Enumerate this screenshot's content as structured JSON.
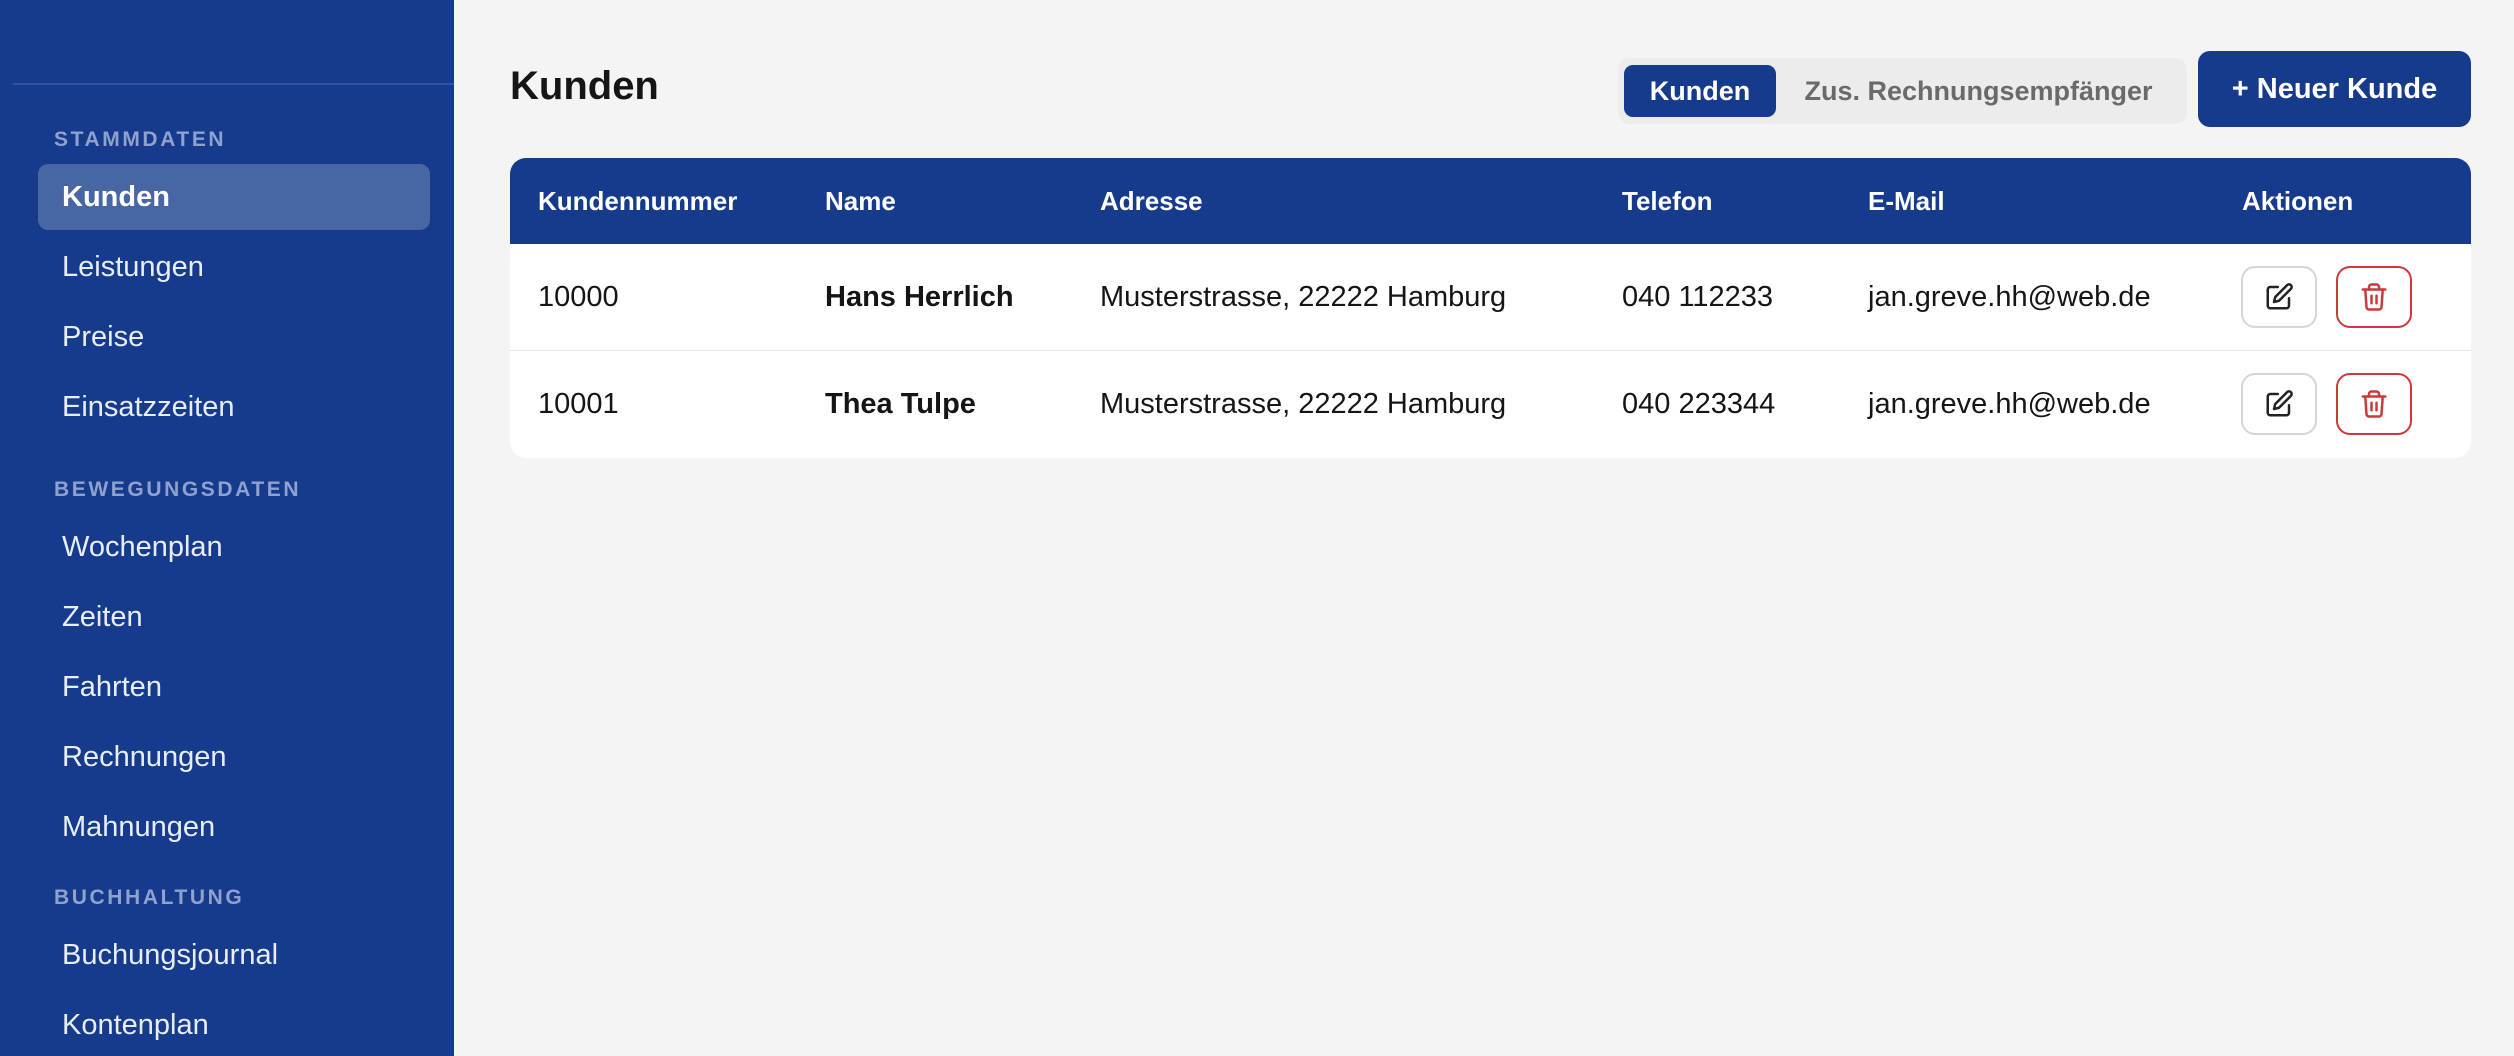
{
  "sidebar": {
    "sections": [
      {
        "title": "STAMMDATEN",
        "items": [
          "Kunden",
          "Leistungen",
          "Preise",
          "Einsatzzeiten"
        ]
      },
      {
        "title": "BEWEGUNGSDATEN",
        "items": [
          "Wochenplan",
          "Zeiten",
          "Fahrten",
          "Rechnungen",
          "Mahnungen"
        ]
      },
      {
        "title": "BUCHHALTUNG",
        "items": [
          "Buchungsjournal",
          "Kontenplan"
        ]
      }
    ],
    "active_item": "Kunden"
  },
  "header": {
    "title": "Kunden",
    "tabs": [
      {
        "label": "Kunden",
        "active": true
      },
      {
        "label": "Zus. Rechnungsempfänger",
        "active": false
      }
    ],
    "new_button_label": "+ Neuer Kunde"
  },
  "table": {
    "columns": [
      "Kundennummer",
      "Name",
      "Adresse",
      "Telefon",
      "E-Mail",
      "Aktionen"
    ],
    "rows": [
      {
        "number": "10000",
        "name": "Hans Herrlich",
        "address": "Musterstrasse, 22222 Hamburg",
        "phone": "040 112233",
        "email": "jan.greve.hh@web.de"
      },
      {
        "number": "10001",
        "name": "Thea Tulpe",
        "address": "Musterstrasse, 22222 Hamburg",
        "phone": "040 223344",
        "email": "jan.greve.hh@web.de"
      }
    ]
  },
  "colors": {
    "brand": "#163a8c",
    "active_nav": "#4865a4",
    "danger": "#c93b3b"
  },
  "icons": {
    "edit": "edit-icon",
    "delete": "trash-icon"
  }
}
